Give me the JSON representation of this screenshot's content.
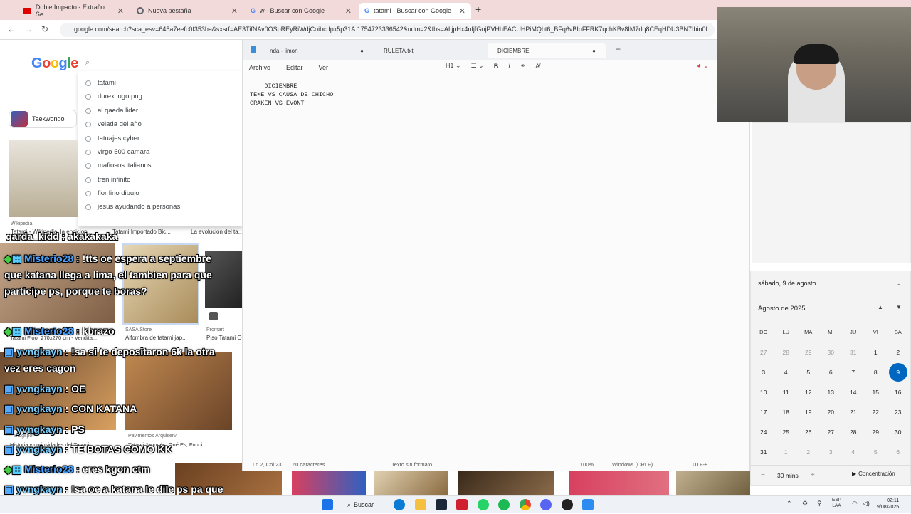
{
  "browser": {
    "tabs": [
      {
        "label": "Doble Impacto - Extraño Se",
        "icon": "youtube-icon",
        "color": "#e00000"
      },
      {
        "label": "Nueva pestaña",
        "icon": "chrome-icon",
        "color": "#5f6368"
      },
      {
        "label": "w - Buscar con Google",
        "icon": "google-icon",
        "color": "#4285f4"
      },
      {
        "label": "tatami - Buscar con Google",
        "icon": "google-icon",
        "color": "#4285f4"
      }
    ],
    "url": "google.com/search?sca_esv=645a7eefc0f353ba&sxsrf=AE3TifNAv0OSpREyRiWdjCoibcdpx5p31A:1754723336542&udm=2&fbs=AIljpHx4nIjfGojPVHhEACUHPiMQht6_BFq6vBIoFFRK7qchKBv8IM7dq8CEqHDU3BN7Ibio0L"
  },
  "google": {
    "logo": "Google",
    "suggestions": [
      "tatami",
      "durex logo png",
      "al qaeda lider",
      "velada del año",
      "tatuajes cyber",
      "virgo 500 camara",
      "mafiosos italianos",
      "tren infinito",
      "flor lirio dibujo",
      "jesus ayudando a personas"
    ],
    "chip": "Taekwondo",
    "captions": {
      "wiki_source": "Wikipedia",
      "wiki": "Tatami - Wikipedia, la enciclop...",
      "c2": "Tatami Importado Bic...",
      "c3": "La evolución del ta...",
      "c4": "Tatami Floor 270x270 cm - Vendita...",
      "c5_source": "SASA Store",
      "c5": "Alfombra de tatami jap...",
      "c6_source": "Promart",
      "c6": "Piso Tatami O...",
      "c7_source": "Blogspot",
      "c7": "Historia y curiosidades del Tatami ...",
      "c8": "Pavimentos Arquiservi",
      "c8b": "Tatami Japonés: Qué Es, Funci..."
    }
  },
  "chat": [
    {
      "user": "",
      "text": "garda_kidd : akakakaka"
    },
    {
      "user": "Misterio28",
      "text": " : !tts oe espera a septiembre que katana llega a lima, el tambien para que participe ps, porque te boras?"
    },
    {
      "user": "Misterio28",
      "text": " : kbrazo"
    },
    {
      "user": "yvngkayn",
      "text": " : !sa si te depositaron 6k la otra vez eres cagon"
    },
    {
      "user": "yvngkayn",
      "text": " : OE"
    },
    {
      "user": "yvngkayn",
      "text": " : CON KATANA"
    },
    {
      "user": "yvngkayn",
      "text": " : PS"
    },
    {
      "user": "yvngkayn",
      "text": " : TE BOTAS COMO KK"
    },
    {
      "user": "Misterio28",
      "text": " : eres kgon ctm"
    },
    {
      "user": "yvngkayn",
      "text": " : !sa oe a katana le dile ps pa que participe"
    }
  ],
  "notepad": {
    "tabs": [
      "nda - limon",
      "RULETA.txt",
      "DICIEMBRE"
    ],
    "menu": [
      "Archivo",
      "Editar",
      "Ver"
    ],
    "heading": "H1",
    "content": "    DICIEMBRE\nTEKE VS CAUSA DE CHICHO\nCRAKEN VS EVONT",
    "status": {
      "position": "Ln 2, Col 23",
      "chars": "60 caracteres",
      "format": "Texto sin formato",
      "zoom": "100%",
      "eol": "Windows (CRLF)",
      "encoding": "UTF-8"
    }
  },
  "calendar": {
    "date_header": "sábado, 9 de agosto",
    "month": "Agosto de 2025",
    "weekdays": [
      "DO",
      "LU",
      "MA",
      "MI",
      "JU",
      "VI",
      "SA"
    ],
    "days": [
      [
        "27",
        "28",
        "29",
        "30",
        "31",
        "1",
        "2"
      ],
      [
        "3",
        "4",
        "5",
        "6",
        "7",
        "8",
        "9"
      ],
      [
        "10",
        "11",
        "12",
        "13",
        "14",
        "15",
        "16"
      ],
      [
        "17",
        "18",
        "19",
        "20",
        "21",
        "22",
        "23"
      ],
      [
        "24",
        "25",
        "26",
        "27",
        "28",
        "29",
        "30"
      ],
      [
        "31",
        "1",
        "2",
        "3",
        "4",
        "5",
        "6"
      ]
    ],
    "today": "9",
    "focus_time": "30 mins",
    "focus_label": "Concentración",
    "accent": "#0067c0"
  },
  "taskbar": {
    "search": "Buscar",
    "lang1": "ESP",
    "lang2": "LAA",
    "time": "02:11",
    "date": "9/08/2025"
  }
}
